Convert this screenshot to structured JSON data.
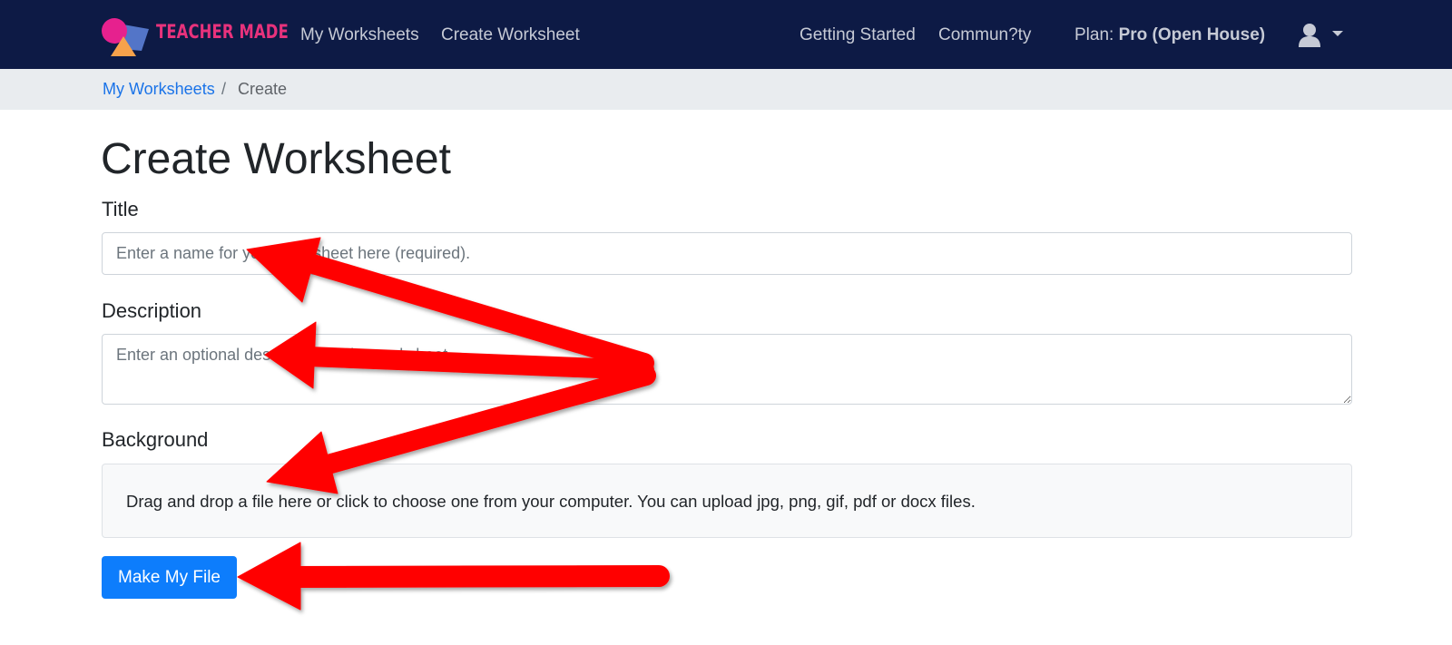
{
  "nav": {
    "brand_text": "TEACHER MADE",
    "links": [
      "My Worksheets",
      "Create Worksheet",
      "Getting Started",
      "Commun?ty"
    ],
    "plan_label": "Plan:",
    "plan_value": "Pro (Open House)",
    "user_icon": "user-icon",
    "caret_icon": "caret-down-icon"
  },
  "breadcrumb": {
    "parent": "My Worksheets",
    "separator": "/",
    "current": "Create"
  },
  "page": {
    "title": "Create Worksheet"
  },
  "form": {
    "title_label": "Title",
    "title_placeholder": "Enter a name for your worksheet here (required).",
    "title_value": "",
    "description_label": "Description",
    "description_placeholder": "Enter an optional description of the worksheet.",
    "description_value": "",
    "background_label": "Background",
    "dropzone_text": "Drag and drop a file here or click to choose one from your computer. You can upload jpg, png, gif, pdf or docx files.",
    "submit_label": "Make My File"
  },
  "colors": {
    "navbar_bg": "#0d1a45",
    "brand_pink": "#e8327c",
    "primary_blue": "#0d7dfc",
    "link_blue": "#1a73e8",
    "annotation_red": "#ff0000"
  }
}
